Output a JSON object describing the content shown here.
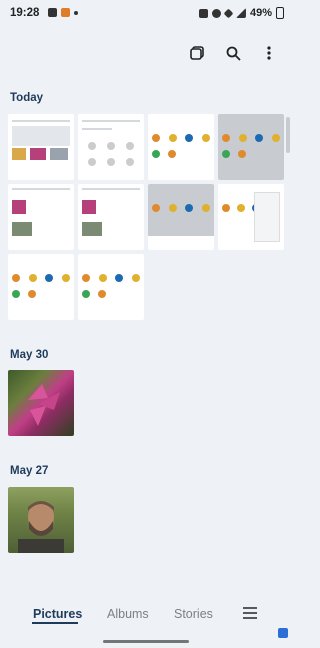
{
  "status_bar": {
    "time": "19:28",
    "battery": "49%"
  },
  "toolbar": {
    "select_icon": "select-icon",
    "search_icon": "search-icon",
    "more_icon": "more-vertical-icon"
  },
  "sections": [
    {
      "title": "Today"
    },
    {
      "title": "May 30"
    },
    {
      "title": "May 27"
    }
  ],
  "nav": {
    "tabs": [
      {
        "label": "Pictures"
      },
      {
        "label": "Albums"
      },
      {
        "label": "Stories"
      }
    ],
    "menu_icon": "hamburger-menu-icon"
  },
  "colors": {
    "background": "#eef2f7",
    "accent": "#1f3b5c"
  }
}
